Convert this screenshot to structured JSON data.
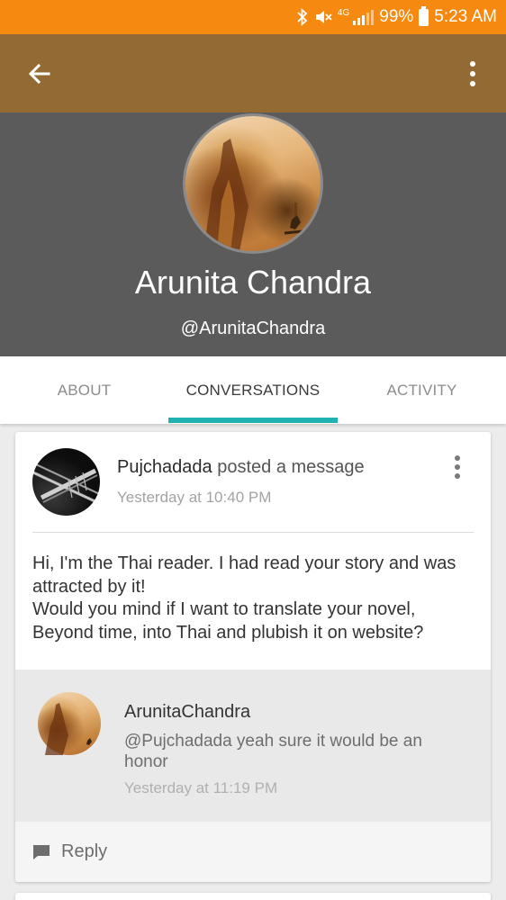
{
  "status_bar": {
    "network": "4G",
    "battery": "99%",
    "time": "5:23 AM",
    "icons": [
      "bluetooth-icon",
      "mute-icon",
      "signal-icon",
      "battery-icon"
    ]
  },
  "app_bar": {
    "back_icon": "arrow-left-icon",
    "more_icon": "more-vert-icon",
    "color": "#946a34"
  },
  "profile": {
    "name": "Arunita Chandra",
    "handle": "@ArunitaChandra"
  },
  "tabs": {
    "items": [
      {
        "label": "ABOUT",
        "active": false
      },
      {
        "label": "CONVERSATIONS",
        "active": true
      },
      {
        "label": "ACTIVITY",
        "active": false
      }
    ],
    "accent": "#1fb2b0"
  },
  "post": {
    "author": "Pujchadada",
    "action": "posted a message",
    "time": "Yesterday at 10:40 PM",
    "body_lines": [
      "Hi, I'm the Thai reader. I had read your story and was attracted by it!",
      "Would you mind if I want to translate your novel, Beyond time, into Thai and plubish it on website?"
    ],
    "reply": {
      "author": "ArunitaChandra",
      "text": "@Pujchadada yeah sure it would be an honor",
      "time": "Yesterday at 11:19 PM"
    },
    "reply_button": "Reply"
  }
}
